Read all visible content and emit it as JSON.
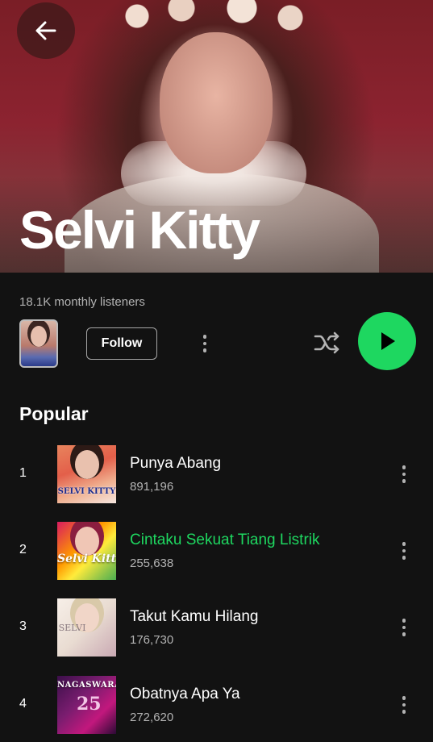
{
  "header": {
    "back_icon": "arrow-left-icon"
  },
  "artist": {
    "name": "Selvi Kitty",
    "monthly_listeners": "18.1K monthly listeners"
  },
  "controls": {
    "follow_label": "Follow",
    "more_icon": "more-vertical-icon",
    "shuffle_icon": "shuffle-icon",
    "play_icon": "play-icon",
    "play_color": "#1ed760"
  },
  "popular": {
    "title": "Popular",
    "tracks": [
      {
        "rank": "1",
        "title": "Punya Abang",
        "plays": "891,196",
        "cover_text": "SELVI KITTY",
        "active": false
      },
      {
        "rank": "2",
        "title": "Cintaku Sekuat Tiang Listrik",
        "plays": "255,638",
        "cover_text": "Selvi Kitty",
        "active": true
      },
      {
        "rank": "3",
        "title": "Takut Kamu Hilang",
        "plays": "176,730",
        "cover_text": "SELVI",
        "active": false
      },
      {
        "rank": "4",
        "title": "Obatnya Apa Ya",
        "plays": "272,620",
        "cover_text": "NAGASWARA",
        "cover_number": "25",
        "active": false
      }
    ]
  },
  "colors": {
    "background": "#121212",
    "accent": "#1ed760",
    "secondary_text": "#b3b3b3"
  }
}
